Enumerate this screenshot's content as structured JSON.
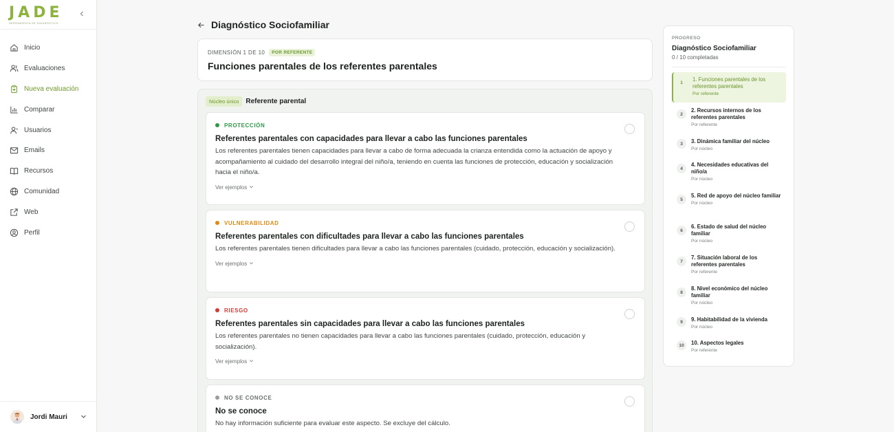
{
  "app": {
    "logo_text": "JADE",
    "logo_tagline": "herramienta de diagnóstico"
  },
  "sidebar": {
    "items": [
      {
        "label": "Inicio",
        "icon": "home-icon"
      },
      {
        "label": "Evaluaciones",
        "icon": "users-icon"
      },
      {
        "label": "Nueva evaluación",
        "icon": "clipboard-icon",
        "active": true
      },
      {
        "label": "Comparar",
        "icon": "bar-chart-icon"
      },
      {
        "label": "Usuarios",
        "icon": "user-icon"
      },
      {
        "label": "Emails",
        "icon": "mail-icon"
      },
      {
        "label": "Recursos",
        "icon": "book-icon"
      },
      {
        "label": "Comunidad",
        "icon": "globe-icon"
      },
      {
        "label": "Web",
        "icon": "external-link-icon"
      },
      {
        "label": "Perfil",
        "icon": "user-circle-icon"
      }
    ],
    "user": {
      "name": "Jordi Mauri"
    }
  },
  "page": {
    "title": "Diagnóstico Sociofamiliar"
  },
  "dimension": {
    "count_label": "Dimensión 1 de 10",
    "scope_badge": "Por referente",
    "title": "Funciones parentales de los referentes parentales"
  },
  "group": {
    "badge": "Núcleo único",
    "title": "Referente parental"
  },
  "options": [
    {
      "level": "Protección",
      "color": "#2e9a47",
      "title": "Referentes parentales con capacidades para llevar a cabo las funciones parentales",
      "description": "Los referentes parentales tienen capacidades para llevar a cabo de forma adecuada la crianza entendida como la actuación de apoyo y acompañamiento al cuidado del desarrollo integral del niño/a, teniendo en cuenta las funciones de protección, educación y socialización hacia el niño/a.",
      "more": "Ver ejemplos"
    },
    {
      "level": "Vulnerabilidad",
      "color": "#e08a12",
      "title": "Referentes parentales con dificultades para llevar a cabo las funciones parentales",
      "description": "Los referentes parentales tienen dificultades para llevar a cabo las funciones parentales (cuidado, protección, educación y socialización).",
      "more": "Ver ejemplos"
    },
    {
      "level": "Riesgo",
      "color": "#d63a36",
      "title": "Referentes parentales sin capacidades para llevar a cabo las funciones parentales",
      "description": "Los referentes parentales no tienen capacidades para llevar a cabo las funciones parentales (cuidado, protección, educación y socialización).",
      "more": "Ver ejemplos"
    },
    {
      "level": "No se conoce",
      "color": "#9a9e9b",
      "title": "No se conoce",
      "description": "No hay información suficiente para evaluar este aspecto. Se excluye del cálculo.",
      "more": ""
    }
  ],
  "progress": {
    "label": "Progreso",
    "title": "Diagnóstico Sociofamiliar",
    "count": "0 / 10 completadas",
    "steps": [
      {
        "num": "1",
        "name": "1. Funciones parentales de los referentes parentales",
        "sub": "Por referente",
        "active": true
      },
      {
        "num": "2",
        "name": "2. Recursos internos de los referentes parentales",
        "sub": "Por referente"
      },
      {
        "num": "3",
        "name": "3. Dinámica familiar del núcleo",
        "sub": "Por núcleo"
      },
      {
        "num": "4",
        "name": "4. Necesidades educativas del niño/a",
        "sub": "Por núcleo"
      },
      {
        "num": "5",
        "name": "5. Red de apoyo del núcleo familiar",
        "sub": "Por núcleo"
      },
      {
        "num": "6",
        "name": "6. Estado de salud del núcleo familiar",
        "sub": "Por núcleo"
      },
      {
        "num": "7",
        "name": "7. Situación laboral de los referentes parentales",
        "sub": "Por referente"
      },
      {
        "num": "8",
        "name": "8. Nivel económico del núcleo familiar",
        "sub": "Por núcleo"
      },
      {
        "num": "9",
        "name": "9. Habitabilidad de la vivienda",
        "sub": "Por núcleo"
      },
      {
        "num": "10",
        "name": "10. Aspectos legales",
        "sub": "Por referente"
      }
    ]
  }
}
